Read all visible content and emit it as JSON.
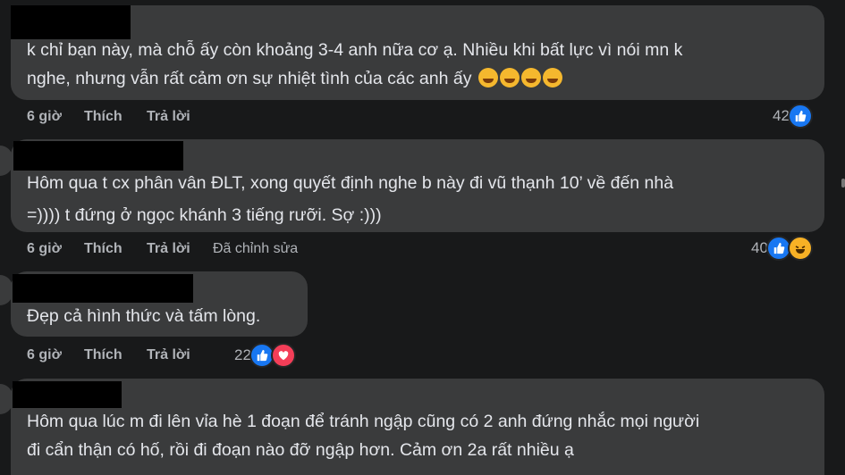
{
  "comments": [
    {
      "text_lines": [
        "k chỉ bạn này, mà chỗ ấy còn khoảng 3-4 anh nữa cơ ạ. Nhiều khi bất lực vì nói mn k",
        "nghe, nhưng vẫn rất cảm ơn sự nhiệt tình của các anh ấy"
      ],
      "emoji": [
        "hugging-face",
        "hugging-face",
        "hugging-face",
        "hugging-face"
      ],
      "time": "6 giờ",
      "like": "Thích",
      "reply": "Trả lời",
      "reaction_count": "42",
      "reactions": [
        "like"
      ]
    },
    {
      "text_lines": [
        "Hôm qua t cx phân vân ĐLT, xong quyết định nghe b này đi vũ thạnh 10’ về đến nhà",
        "=)))) t đứng ở ngọc khánh 3 tiếng rưỡi. Sợ :)))"
      ],
      "time": "6 giờ",
      "like": "Thích",
      "reply": "Trả lời",
      "edited": "Đã chỉnh sửa",
      "reaction_count": "40",
      "reactions": [
        "like",
        "haha"
      ]
    },
    {
      "text_lines": [
        "Đẹp cả hình thức và tấm lòng."
      ],
      "time": "6 giờ",
      "like": "Thích",
      "reply": "Trả lời",
      "reaction_count": "22",
      "reactions": [
        "like",
        "love"
      ]
    },
    {
      "text_lines": [
        "Hôm qua lúc m đi lên vỉa hè 1 đoạn để tránh ngập cũng có 2 anh đứng nhắc mọi người",
        "đi cẩn thận có hố, rồi đi đoạn nào đỡ ngập hơn. Cảm ơn 2a rất nhiều ạ"
      ]
    }
  ],
  "colors": {
    "background": "#18191a",
    "bubble": "#3a3b3c",
    "text": "#e4e6eb",
    "meta": "#b0b3b8",
    "like": "#1877f2",
    "love": "#f33e58",
    "haha": "#f7b125"
  }
}
